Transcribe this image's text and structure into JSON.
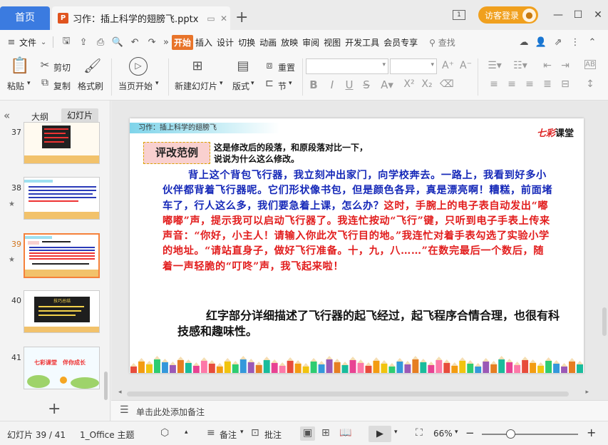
{
  "titlebar": {
    "home_tab": "首页",
    "doc_icon": "P",
    "doc_tab": "习作：插上科学的翅膀飞.pptx",
    "new_tab": "+",
    "visitor": "访客登录",
    "box_label": "1"
  },
  "menu": {
    "file": "文件",
    "items": [
      "开始",
      "插入",
      "设计",
      "切换",
      "动画",
      "放映",
      "审阅",
      "视图",
      "开发工具",
      "会员专享"
    ],
    "search": "查找"
  },
  "ribbon": {
    "paste": "粘贴",
    "cut": "剪切",
    "copy": "复制",
    "format_painter": "格式刷",
    "from_current": "当页开始",
    "new_slide": "新建幻灯片",
    "layout": "版式",
    "reset": "重置",
    "section": "节"
  },
  "left_pane": {
    "tab_outline": "大纲",
    "tab_slides": "幻灯片",
    "thumbs": [
      {
        "num": "37",
        "star": ""
      },
      {
        "num": "38",
        "star": "★"
      },
      {
        "num": "39",
        "star": "★"
      },
      {
        "num": "40",
        "star": ""
      },
      {
        "num": "41",
        "star": ""
      }
    ],
    "thumb40_title": "技巧总结",
    "thumb41_text": "七彩课堂　伴你成长",
    "add": "+"
  },
  "slide": {
    "header": "习作：插上科学的翅膀飞",
    "logo_a": "七彩",
    "logo_b": "课堂",
    "badge": "评改范例",
    "instruction_1": "这是修改后的段落，和原段落对比一下，",
    "instruction_2": "说说为什么这么修改。",
    "para_blue": "背上这个背包飞行器，我立刻冲出家门，向学校奔去。一路上，我看到好多小伙伴都背着飞行器呢。它们形状像书包，但是颜色各异，真是漂亮啊！糟糕，前面堵车了，行人这么多，我们要急着上课，怎么办？",
    "para_red": "这时，手腕上的电子表自动发出“嘟嘟嘟”声，提示我可以启动飞行器了。我连忙按动“飞行”键，只听到电子手表上传来声音：“你好，小主人！请输入你此次飞行目的地。”我连忙对着手表勾选了实验小学的地址。“请站直身子，做好飞行准备。十，九，八……”在数完最后一个数后，随着一声轻脆的“叮咚”声，我飞起来啦！",
    "comment": "红字部分详细描述了飞行器的起飞经过，起飞程序合情合理，也很有科技感和趣味性。"
  },
  "notes": {
    "placeholder": "单击此处添加备注"
  },
  "status": {
    "slide_count": "幻灯片 39 / 41",
    "theme": "1_Office 主题",
    "notes": "备注",
    "comments": "批注",
    "zoom": "66%",
    "zoom_value": 0.3
  },
  "colors": {
    "accent": "#3b7be0",
    "orange": "#e8742a",
    "blue_text": "#1528b8",
    "red_text": "#e21d1d"
  }
}
